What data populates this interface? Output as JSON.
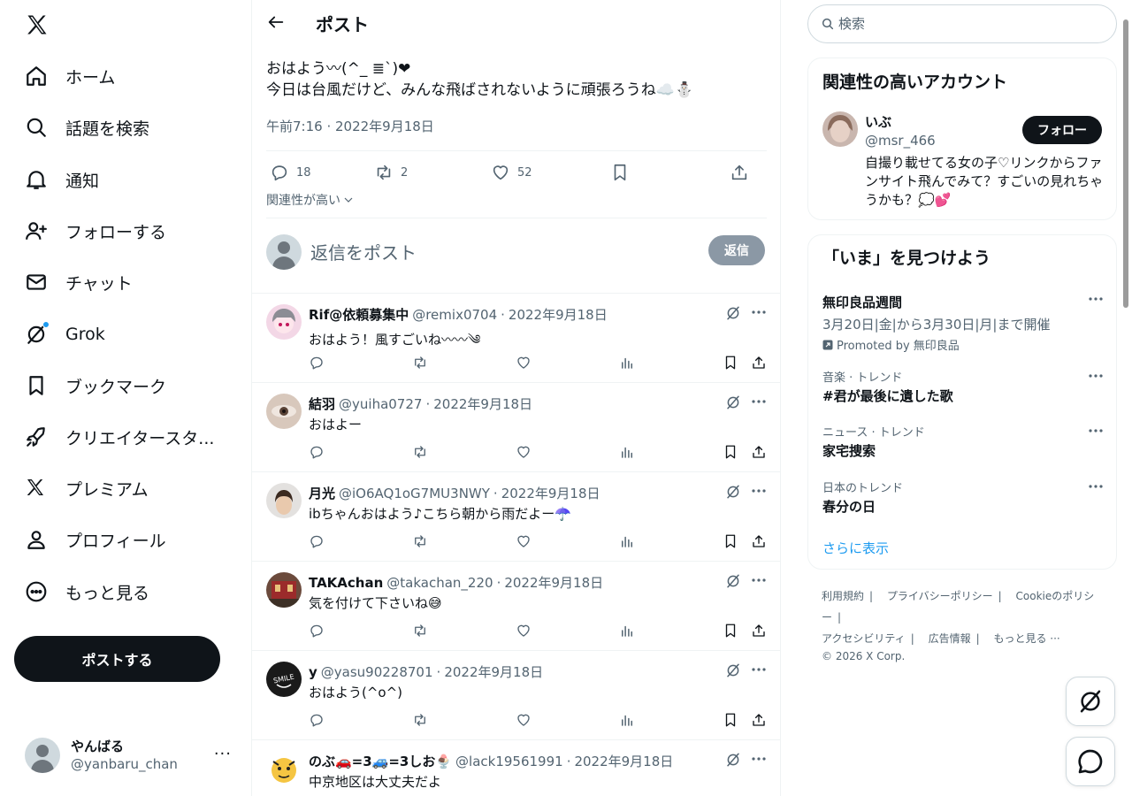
{
  "nav": {
    "items": [
      {
        "label": "ホーム",
        "icon": "home-icon"
      },
      {
        "label": "話題を検索",
        "icon": "search-icon"
      },
      {
        "label": "通知",
        "icon": "bell-icon"
      },
      {
        "label": "フォローする",
        "icon": "person-add-icon"
      },
      {
        "label": "チャット",
        "icon": "mail-icon"
      },
      {
        "label": "Grok",
        "icon": "grok-icon"
      },
      {
        "label": "ブックマーク",
        "icon": "bookmark-icon"
      },
      {
        "label": "クリエイタースタ...",
        "icon": "rocket-icon"
      },
      {
        "label": "プレミアム",
        "icon": "x-logo-icon"
      },
      {
        "label": "プロフィール",
        "icon": "profile-icon"
      },
      {
        "label": "もっと見る",
        "icon": "more-circle-icon"
      }
    ],
    "post_button": "ポストする",
    "account": {
      "name": "やんばる",
      "handle": "@yanbaru_chan",
      "more": "···"
    }
  },
  "header": {
    "title": "ポスト"
  },
  "focus_post": {
    "text_line1": "おはよう〰(^_ ≣`)❤",
    "text_line2": "今日は台風だけど、みんな飛ばされないように頑張ろうね☁️⛄",
    "time": "午前7:16 · 2022年9月18日",
    "reply_count": "18",
    "repost_count": "2",
    "like_count": "52",
    "sort_label": "関連性が高い"
  },
  "reply_composer": {
    "placeholder": "返信をポスト",
    "button": "返信"
  },
  "replies": [
    {
      "name": "Rif@依頼募集中",
      "handle": "@remix0704",
      "date": "2022年9月18日",
      "text": "おはよう！風すごいね〰〰༄"
    },
    {
      "name": "結羽",
      "handle": "@yuiha0727",
      "date": "2022年9月18日",
      "text": "おはよー"
    },
    {
      "name": "月光",
      "handle": "@iO6AQ1oG7MU3NWY",
      "date": "2022年9月18日",
      "text": "ibちゃんおはよう♪こちら朝から雨だよー☂️"
    },
    {
      "name": "TAKAchan",
      "handle": "@takachan_220",
      "date": "2022年9月18日",
      "text": "気を付けて下さいね😅"
    },
    {
      "name": "y",
      "handle": "@yasu90228701",
      "date": "2022年9月18日",
      "text": "おはよう(^o^)"
    },
    {
      "name": "のぶ🚗=3🚙=3しお🍨",
      "handle": "@lack19561991",
      "date": "2022年9月18日",
      "text": "中京地区は大丈夫だよ"
    }
  ],
  "right": {
    "search_placeholder": "検索",
    "who": {
      "title": "関連性の高いアカウント",
      "name": "いぶ",
      "handle": "@msr_466",
      "follow": "フォロー",
      "bio": "自撮り載せてる女の子♡リンクからファンサイト飛んでみて？すごいの見れちゃうかも？💭💕"
    },
    "trends": {
      "title": "「いま」を見つけよう",
      "promoted": {
        "title": "無印良品週間",
        "sub": "3月20日|金|から3月30日|月|まで開催",
        "promo": "Promoted by 無印良品"
      },
      "items": [
        {
          "meta": "音楽 · トレンド",
          "title": "#君が最後に遺した歌"
        },
        {
          "meta": "ニュース · トレンド",
          "title": "家宅捜索"
        },
        {
          "meta": "日本のトレンド",
          "title": "春分の日"
        }
      ],
      "show_more": "さらに表示"
    },
    "footer": {
      "links": [
        "利用規約",
        "プライバシーポリシー",
        "Cookieのポリシー",
        "アクセシビリティ",
        "広告情報",
        "もっと見る ···"
      ],
      "copyright": "© 2026 X Corp."
    }
  },
  "colors": {
    "accent": "#1d9bf0",
    "text": "#0f1419",
    "muted": "#536471",
    "border": "#eff3f4"
  }
}
